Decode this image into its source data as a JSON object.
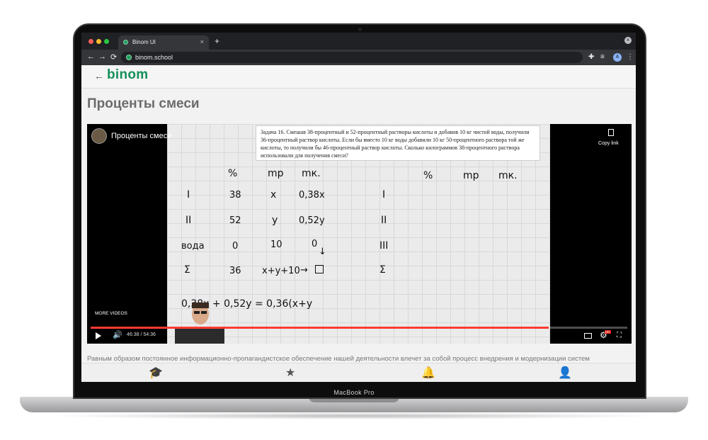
{
  "device": {
    "model": "MacBook Pro"
  },
  "browser": {
    "tab_title": "Binom UI",
    "tab_close": "×",
    "new_tab": "+",
    "window_close": "×",
    "nav": {
      "back": "←",
      "forward": "→",
      "reload": "⟳"
    },
    "url": "binom.school",
    "profile_initial": "A",
    "traffic_lights": [
      "#ff5f57",
      "#febc2e",
      "#28c840"
    ]
  },
  "app": {
    "brand": "binom",
    "brand_color": "#14905a",
    "back_arrow": "←",
    "page_title": "Проценты смеси"
  },
  "video": {
    "channel_title": "Проценты смеси",
    "copy_link": "Copy link",
    "more_videos": "MORE VIDEOS",
    "time": "46:38 / 54:36",
    "progress": 0.854,
    "task_text": "Задача 16. Смешав 38-процентный и 52-процентный растворы кислоты и добавив 10 кг чистой воды, получили 36-процентный раствор кислоты. Если бы вместо 10 кг воды добавили 10 кг 50-процентного раствора той же кислоты, то получили бы 46-процентный раствор кислоты. Сколько килограммов 38-процентного раствора использовали для получения смеси?",
    "board_left": {
      "headers": [
        "%",
        "mр",
        "mк."
      ],
      "rows": [
        {
          "label": "I",
          "pct": "38",
          "mr": "x",
          "mk": "0,38x"
        },
        {
          "label": "II",
          "pct": "52",
          "mr": "y",
          "mk": "0,52y"
        },
        {
          "label": "вода",
          "pct": "0",
          "mr": "10",
          "mk": "0"
        },
        {
          "label": "Σ",
          "pct": "36",
          "mr": "x+y+10",
          "mk": ""
        }
      ],
      "equation": "0,38x + 0,52y = 0,36(x+y"
    },
    "board_right": {
      "headers": [
        "%",
        "mр",
        "mк."
      ],
      "rows": [
        "I",
        "II",
        "III",
        "Σ"
      ]
    }
  },
  "description": "Равным образом постоянное информационно-пропагандистское обеспечение нашей деятельности влечет за собой процесс внедрения и модернизации систем",
  "bottom_nav": [
    {
      "icon": "graduation-cap-icon",
      "glyph": "🎓"
    },
    {
      "icon": "star-icon",
      "glyph": "★"
    },
    {
      "icon": "bell-icon",
      "glyph": "🔔"
    },
    {
      "icon": "user-icon",
      "glyph": "👤"
    }
  ]
}
